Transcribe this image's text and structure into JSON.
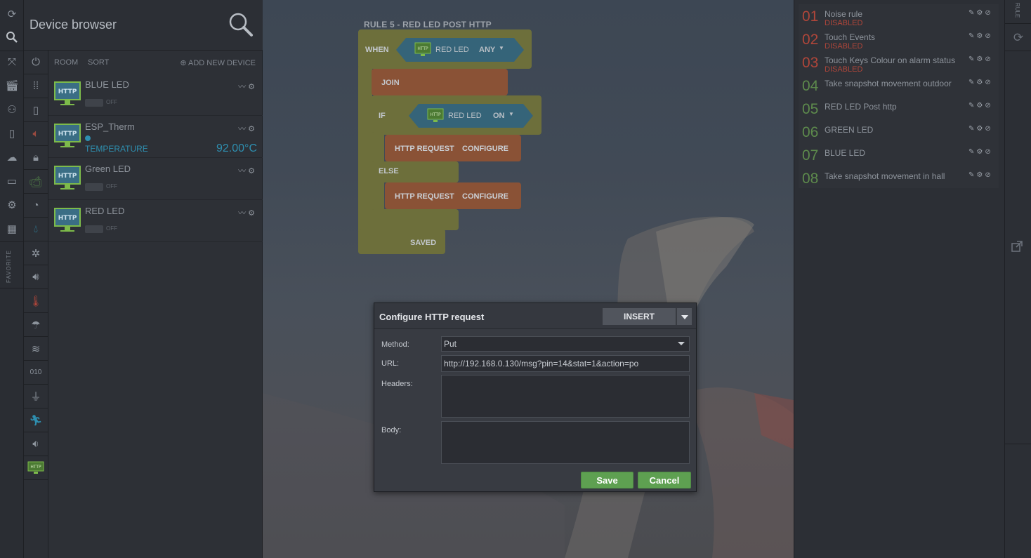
{
  "browser": {
    "title": "Device browser",
    "room_label": "ROOM",
    "sort_label": "SORT",
    "add_device_label": "ADD NEW DEVICE",
    "devices": [
      {
        "name": "BLUE LED",
        "icon_text": "HTTP",
        "state": "OFF"
      },
      {
        "name": "ESP_Therm",
        "icon_text": "HTTP",
        "sensor": "TEMPERATURE",
        "value": "92.00°C"
      },
      {
        "name": "Green LED",
        "icon_text": "HTTP",
        "state": "OFF"
      },
      {
        "name": "RED LED",
        "icon_text": "HTTP",
        "state": "OFF"
      }
    ]
  },
  "rail": {
    "favorite_label": "FAVORITE",
    "icons": [
      "refresh-icon",
      "search-icon",
      "zoom-fit-icon",
      "clapperboard-icon",
      "users-icon",
      "document-icon",
      "cloud-icon",
      "folder-icon",
      "settings-icon",
      "calendar-icon"
    ]
  },
  "categories": {
    "icons": [
      "power-icon",
      "dots-icon",
      "door-icon",
      "speaker-icon",
      "lock-icon",
      "camera-icon",
      "gauge-icon",
      "drop-icon",
      "fan-icon",
      "volume-icon",
      "thermometer-icon",
      "weather-icon",
      "vibration-icon",
      "binary-icon",
      "plug-icon",
      "motion-icon",
      "siren-icon",
      "http-icon"
    ],
    "http_text": "HTTP"
  },
  "workspace": {
    "rule_title": "RULE 5 - RED LED POST HTTP",
    "when_label": "WHEN",
    "when_device": "RED LED",
    "when_state": "ANY",
    "join_label": "JOIN",
    "if_label": "IF",
    "if_device": "RED LED",
    "if_state": "ON",
    "http_request_label": "HTTP REQUEST",
    "configure_label": "CONFIGURE",
    "else_label": "ELSE",
    "saved_label": "SAVED",
    "icon_text": "HTTP"
  },
  "dialog": {
    "title": "Configure HTTP request",
    "insert_label": "INSERT",
    "method_label": "Method:",
    "method_value": "Put",
    "url_label": "URL:",
    "url_value": "http://192.168.0.130/msg?pin=14&stat=1&action=po",
    "headers_label": "Headers:",
    "headers_value": "",
    "body_label": "Body:",
    "body_value": "",
    "save_label": "Save",
    "cancel_label": "Cancel"
  },
  "rules": {
    "items": [
      {
        "num": "01",
        "name": "Noise rule",
        "status": "DISABLED",
        "color": "#b0463a"
      },
      {
        "num": "02",
        "name": "Touch Events",
        "status": "DISABLED",
        "color": "#b0463a"
      },
      {
        "num": "03",
        "name": "Touch Keys Colour on alarm status",
        "status": "DISABLED",
        "color": "#b0463a"
      },
      {
        "num": "04",
        "name": "Take snapshot movement outdoor",
        "status": "",
        "color": "#5d8a4c"
      },
      {
        "num": "05",
        "name": "RED LED Post http",
        "status": "",
        "color": "#5d8a4c"
      },
      {
        "num": "06",
        "name": "GREEN LED",
        "status": "",
        "color": "#5d8a4c"
      },
      {
        "num": "07",
        "name": "BLUE LED",
        "status": "",
        "color": "#5d8a4c"
      },
      {
        "num": "08",
        "name": "Take snapshot movement in hall",
        "status": "",
        "color": "#5d8a4c"
      }
    ]
  },
  "strip": {
    "label": "RULE"
  }
}
